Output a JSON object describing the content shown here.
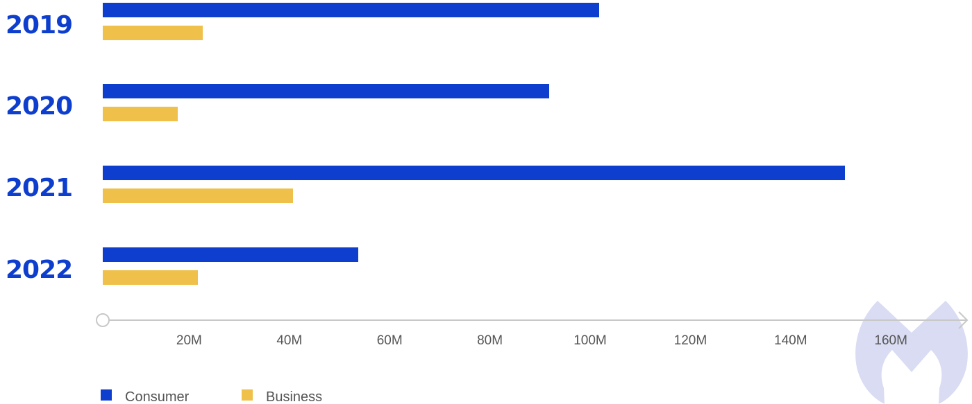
{
  "chart_data": {
    "type": "bar",
    "orientation": "horizontal",
    "title": "",
    "xlabel": "",
    "ylabel": "",
    "categories": [
      "2019",
      "2020",
      "2021",
      "2022"
    ],
    "series": [
      {
        "name": "Consumer",
        "color": "#0e3ecd",
        "values": [
          99,
          89,
          148,
          51
        ]
      },
      {
        "name": "Business",
        "color": "#efc04a",
        "values": [
          20,
          15,
          38,
          19
        ]
      }
    ],
    "units": "M",
    "xlim": [
      0,
      170
    ],
    "xticks": [
      20,
      40,
      60,
      80,
      100,
      120,
      140,
      160
    ],
    "xtick_labels": [
      "20M",
      "40M",
      "60M",
      "80M",
      "100M",
      "120M",
      "140M",
      "160M"
    ],
    "grid": false,
    "legend": {
      "placement": "bottom-left",
      "entries": [
        "Consumer",
        "Business"
      ]
    }
  },
  "watermark": {
    "name": "malwarebytes-logo",
    "color": "#d9dcf2"
  },
  "axis_color": "#c8c8c8"
}
